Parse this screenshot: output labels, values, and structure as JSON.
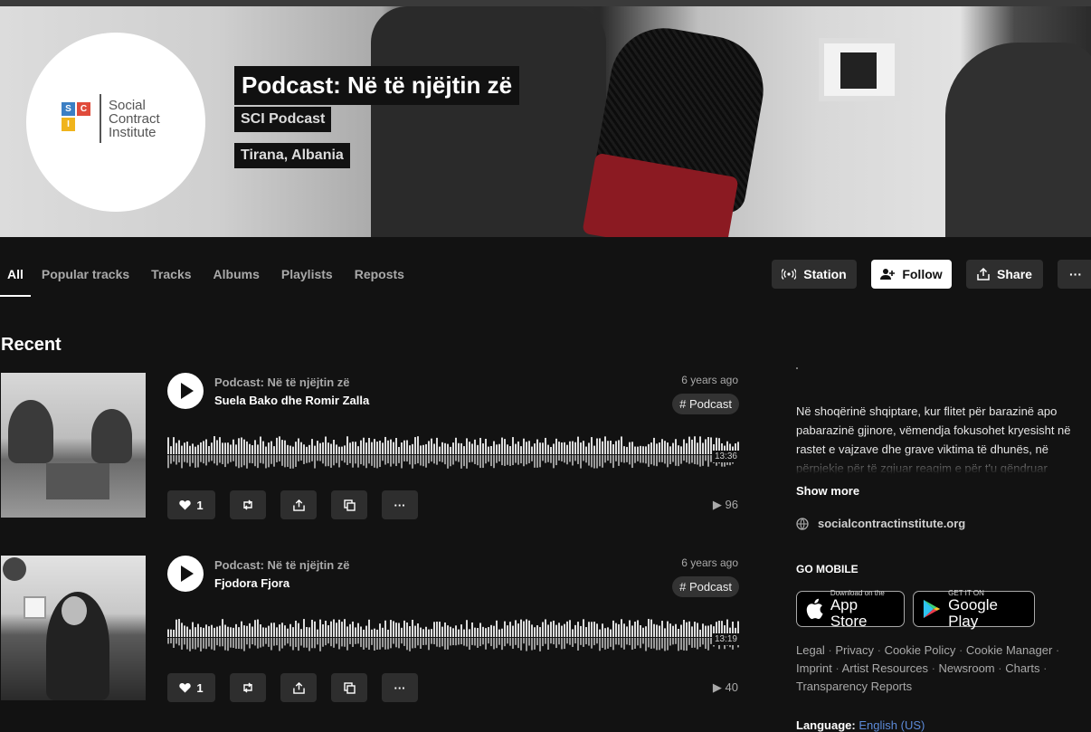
{
  "header": {
    "title": "Podcast: Në të njëjtin zë",
    "subtitle": "SCI Podcast",
    "location": "Tirana, Albania",
    "logo": {
      "letters": [
        "S",
        "C",
        "I"
      ],
      "text": [
        "Social",
        "Contract",
        "Institute"
      ]
    }
  },
  "tabs": [
    "All",
    "Popular tracks",
    "Tracks",
    "Albums",
    "Playlists",
    "Reposts"
  ],
  "actions": {
    "station": "Station",
    "follow": "Follow",
    "share": "Share",
    "more": "···"
  },
  "section_title": "Recent",
  "tracks": [
    {
      "uploader": "Podcast: Në të njëjtin zë",
      "title": "Suela Bako dhe Romir Zalla",
      "date": "6 years ago",
      "tag": "# Podcast",
      "duration": "13:36",
      "likes": "1",
      "plays": "96"
    },
    {
      "uploader": "Podcast: Në të njëjtin zë",
      "title": "Fjodora Fjora",
      "date": "6 years ago",
      "tag": "# Podcast",
      "duration": "13:19",
      "likes": "1",
      "plays": "40"
    }
  ],
  "sidebar": {
    "description": "Në shoqërinë shqiptare, kur flitet për barazinë apo pabarazinë gjinore, vëmendja fokusohet kryesisht në rastet e vajzave dhe grave viktima të dhunës, në përpjekje për të zgjuar reagim e për t'u qëndruar",
    "show_more": "Show more",
    "website": "socialcontractinstitute.org",
    "go_mobile": "GO MOBILE",
    "app_store": {
      "small": "Download on the",
      "big": "App Store"
    },
    "google_play": {
      "small": "GET IT ON",
      "big": "Google Play"
    },
    "footer_links": [
      "Legal",
      "Privacy",
      "Cookie Policy",
      "Cookie Manager",
      "Imprint",
      "Artist Resources",
      "Newsroom",
      "Charts",
      "Transparency Reports"
    ],
    "language_label": "Language:",
    "language_value": "English (US)"
  },
  "colors": {
    "background": "#121212",
    "accent_link": "#5c8ad8"
  }
}
